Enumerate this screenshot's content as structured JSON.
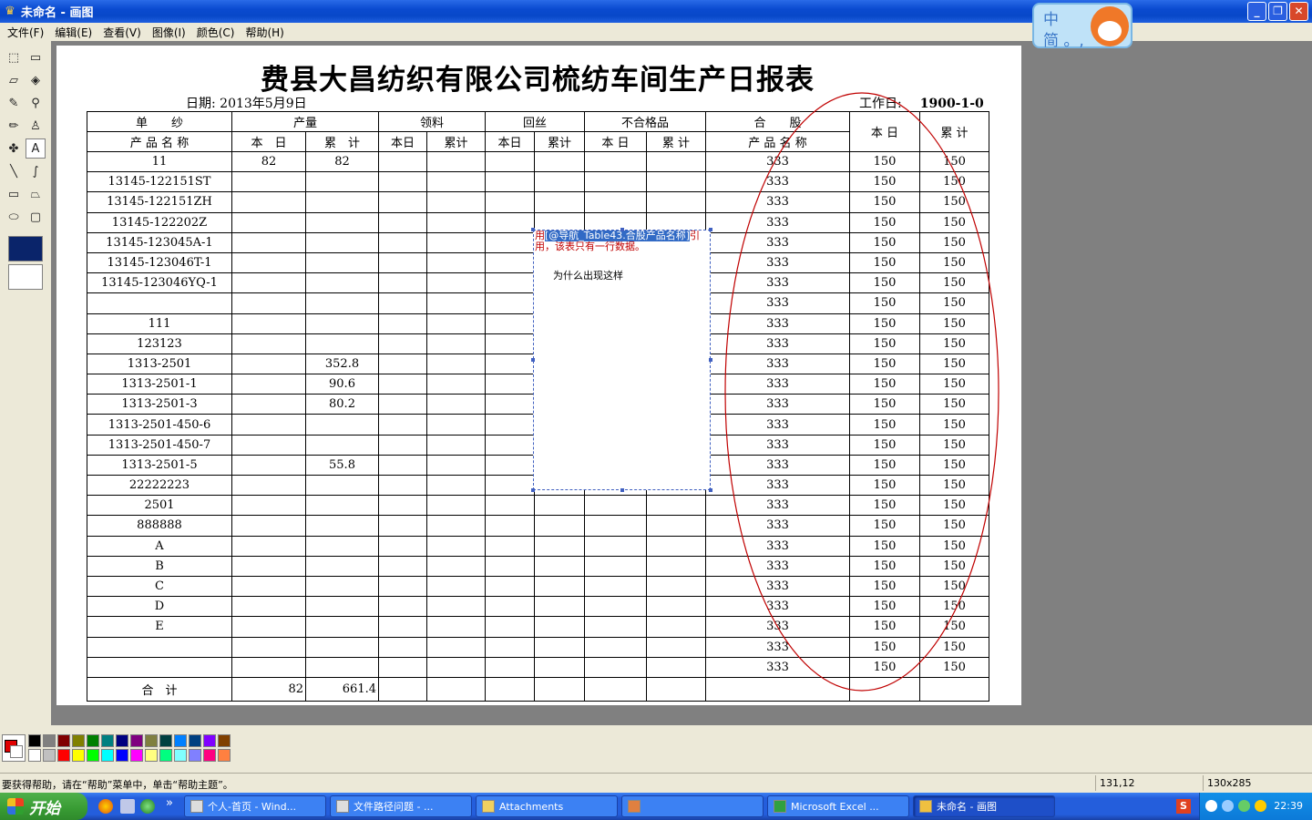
{
  "window": {
    "title": "未命名 - 画图",
    "buttons": {
      "minimize": "_",
      "restore": "❐",
      "close": "✕"
    }
  },
  "ime": {
    "line1": "中",
    "line2": "简 。,"
  },
  "menu": [
    "文件(F)",
    "编辑(E)",
    "查看(V)",
    "图像(I)",
    "颜色(C)",
    "帮助(H)"
  ],
  "tools": [
    {
      "name": "free-select-icon",
      "glyph": "⬚"
    },
    {
      "name": "rect-select-icon",
      "glyph": "▭"
    },
    {
      "name": "eraser-icon",
      "glyph": "▱"
    },
    {
      "name": "fill-icon",
      "glyph": "◈"
    },
    {
      "name": "color-picker-icon",
      "glyph": "✎"
    },
    {
      "name": "magnifier-icon",
      "glyph": "⚲"
    },
    {
      "name": "pencil-icon",
      "glyph": "✏"
    },
    {
      "name": "brush-icon",
      "glyph": "♙"
    },
    {
      "name": "airbrush-icon",
      "glyph": "✤"
    },
    {
      "name": "text-icon",
      "glyph": "A"
    },
    {
      "name": "line-icon",
      "glyph": "╲"
    },
    {
      "name": "curve-icon",
      "glyph": "∫"
    },
    {
      "name": "rectangle-icon",
      "glyph": "▭"
    },
    {
      "name": "polygon-icon",
      "glyph": "⏢"
    },
    {
      "name": "ellipse-icon",
      "glyph": "⬭"
    },
    {
      "name": "rounded-rect-icon",
      "glyph": "▢"
    }
  ],
  "report": {
    "title": "费县大昌纺织有限公司梳纺车间生产日报表",
    "date_label": "日期:",
    "date_value": "2013年5月9日",
    "workday_label": "工作日:",
    "workday_value": "1900-1-0",
    "header1": [
      "单　　纱",
      "产量",
      "领料",
      "回丝",
      "不合格品",
      "合　　股",
      "本 日",
      "累 计"
    ],
    "header1b": "产 品 名 称",
    "header2": [
      "本　日",
      "累　计",
      "本日",
      "累计",
      "本日",
      "累计",
      "本 日",
      "累 计"
    ],
    "header2b": "产 品 名 称",
    "rows": [
      [
        "11",
        "82",
        "82",
        "333",
        "150",
        "150"
      ],
      [
        "13145-122151ST",
        "",
        "",
        "333",
        "150",
        "150"
      ],
      [
        "13145-122151ZH",
        "",
        "",
        "333",
        "150",
        "150"
      ],
      [
        "13145-122202Z",
        "",
        "",
        "333",
        "150",
        "150"
      ],
      [
        "13145-123045A-1",
        "",
        "",
        "333",
        "150",
        "150"
      ],
      [
        "13145-123046T-1",
        "",
        "",
        "333",
        "150",
        "150"
      ],
      [
        "13145-123046YQ-1",
        "",
        "",
        "333",
        "150",
        "150"
      ],
      [
        "",
        "",
        "",
        "333",
        "150",
        "150"
      ],
      [
        "111",
        "",
        "",
        "333",
        "150",
        "150"
      ],
      [
        "123123",
        "",
        "",
        "333",
        "150",
        "150"
      ],
      [
        "1313-2501",
        "",
        "352.8",
        "333",
        "150",
        "150"
      ],
      [
        "1313-2501-1",
        "",
        "90.6",
        "333",
        "150",
        "150"
      ],
      [
        "1313-2501-3",
        "",
        "80.2",
        "333",
        "150",
        "150"
      ],
      [
        "1313-2501-450-6",
        "",
        "",
        "333",
        "150",
        "150"
      ],
      [
        "1313-2501-450-7",
        "",
        "",
        "333",
        "150",
        "150"
      ],
      [
        "1313-2501-5",
        "",
        "55.8",
        "333",
        "150",
        "150"
      ],
      [
        "22222223",
        "",
        "",
        "333",
        "150",
        "150"
      ],
      [
        "2501",
        "",
        "",
        "333",
        "150",
        "150"
      ],
      [
        "888888",
        "",
        "",
        "333",
        "150",
        "150"
      ],
      [
        "A",
        "",
        "",
        "333",
        "150",
        "150"
      ],
      [
        "B",
        "",
        "",
        "333",
        "150",
        "150"
      ],
      [
        "C",
        "",
        "",
        "333",
        "150",
        "150"
      ],
      [
        "D",
        "",
        "",
        "333",
        "150",
        "150"
      ],
      [
        "E",
        "",
        "",
        "333",
        "150",
        "150"
      ],
      [
        "",
        "",
        "",
        "333",
        "150",
        "150"
      ],
      [
        "",
        "",
        "",
        "333",
        "150",
        "150"
      ]
    ],
    "total": {
      "label": "合　计",
      "day": "82",
      "cum": "661.4"
    }
  },
  "textbox": {
    "error_prefix": "用",
    "error_highlight": "[@导航_Table43.合股产品名称]",
    "error_suffix": "引",
    "error_line2": "用，该表只有一行数据。",
    "question": "为什么出现这样"
  },
  "palette": {
    "fg": "#e00000",
    "bg": "#ffffff",
    "row1": [
      "#000000",
      "#808080",
      "#800000",
      "#808000",
      "#008000",
      "#008080",
      "#000080",
      "#800080",
      "#808040",
      "#004040",
      "#0080ff",
      "#004080",
      "#8000ff",
      "#804000"
    ],
    "row2": [
      "#ffffff",
      "#c0c0c0",
      "#ff0000",
      "#ffff00",
      "#00ff00",
      "#00ffff",
      "#0000ff",
      "#ff00ff",
      "#ffff80",
      "#00ff80",
      "#80ffff",
      "#8080ff",
      "#ff0080",
      "#ff8040"
    ]
  },
  "status": {
    "help": "要获得帮助，请在“帮助”菜单中，单击“帮助主题”。",
    "coords": "131,12",
    "size": "130x285"
  },
  "taskbar": {
    "start": "开始",
    "chevron": "»",
    "buttons": [
      "个人-首页 - Wind...",
      "文件路径问题 - ...",
      "Attachments",
      "",
      "Microsoft Excel ...",
      "未命名 - 画图"
    ],
    "tray_icon": "S",
    "time": "22:39"
  },
  "colors": {
    "ellipse": "#c00000",
    "titlebar": "#0848c8"
  }
}
